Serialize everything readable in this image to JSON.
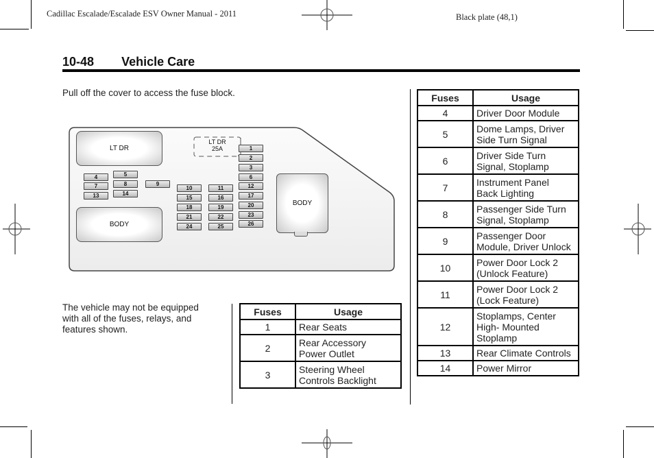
{
  "header": {
    "manual_title": "Cadillac Escalade/Escalade ESV Owner Manual - 2011",
    "plate": "Black plate (48,1)"
  },
  "page": {
    "number": "10-48",
    "section": "Vehicle Care"
  },
  "intro_text": "Pull off the cover to access the fuse block.",
  "note_text_lines": [
    "The vehicle may not be equipped",
    "with all of the fuses, relays, and",
    "features shown."
  ],
  "diagram": {
    "relays": {
      "lt_dr": "LT DR",
      "body_left": "BODY",
      "body_right": "BODY",
      "spare_line1": "LT DR",
      "spare_line2": "25A"
    },
    "fuses": [
      "1",
      "2",
      "3",
      "4",
      "5",
      "6",
      "7",
      "8",
      "9",
      "10",
      "11",
      "12",
      "13",
      "14",
      "15",
      "16",
      "17",
      "18",
      "19",
      "20",
      "21",
      "22",
      "23",
      "24",
      "25",
      "26"
    ]
  },
  "table_left": {
    "headers": [
      "Fuses",
      "Usage"
    ],
    "rows": [
      {
        "fuse": "1",
        "usage": [
          "Rear Seats"
        ]
      },
      {
        "fuse": "2",
        "usage": [
          "Rear Accessory",
          "Power Outlet"
        ]
      },
      {
        "fuse": "3",
        "usage": [
          "Steering Wheel",
          "Controls Backlight"
        ]
      }
    ]
  },
  "table_right": {
    "headers": [
      "Fuses",
      "Usage"
    ],
    "rows": [
      {
        "fuse": "4",
        "usage": [
          "Driver Door Module"
        ]
      },
      {
        "fuse": "5",
        "usage": [
          "Dome Lamps, Driver",
          "Side Turn Signal"
        ]
      },
      {
        "fuse": "6",
        "usage": [
          "Driver Side Turn",
          "Signal, Stoplamp"
        ]
      },
      {
        "fuse": "7",
        "usage": [
          "Instrument Panel",
          "Back Lighting"
        ]
      },
      {
        "fuse": "8",
        "usage": [
          "Passenger Side Turn",
          "Signal, Stoplamp"
        ]
      },
      {
        "fuse": "9",
        "usage": [
          "Passenger Door",
          "Module, Driver Unlock"
        ]
      },
      {
        "fuse": "10",
        "usage": [
          "Power Door Lock 2",
          "(Unlock Feature)"
        ]
      },
      {
        "fuse": "11",
        "usage": [
          "Power Door Lock 2",
          "(Lock Feature)"
        ]
      },
      {
        "fuse": "12",
        "usage": [
          "Stoplamps, Center",
          "High- Mounted",
          "Stoplamp"
        ]
      },
      {
        "fuse": "13",
        "usage": [
          "Rear Climate Controls"
        ]
      },
      {
        "fuse": "14",
        "usage": [
          "Power Mirror"
        ]
      }
    ]
  }
}
